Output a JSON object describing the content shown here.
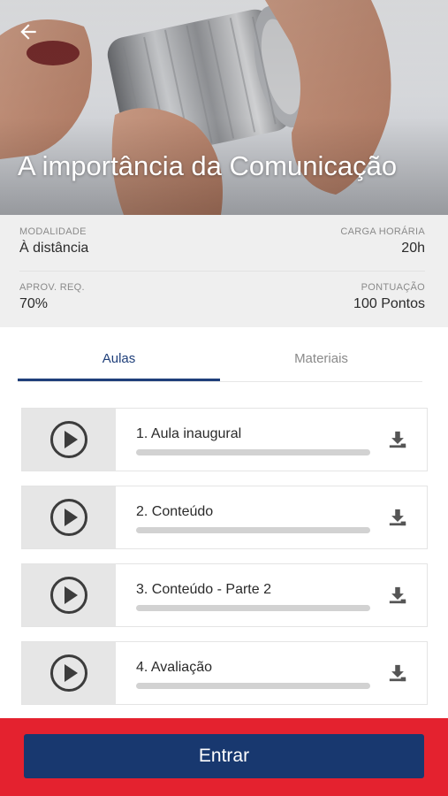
{
  "course": {
    "title": "A importância da Comunicação"
  },
  "icons": {
    "back": "arrow-left-icon",
    "play": "play-circle-icon",
    "download": "download-icon"
  },
  "info": {
    "modality_label": "MODALIDADE",
    "modality_value": "À distância",
    "hours_label": "CARGA HORÁRIA",
    "hours_value": "20h",
    "approval_label": "APROV. REQ.",
    "approval_value": "70%",
    "score_label": "PONTUAÇÃO",
    "score_value": "100 Pontos"
  },
  "tabs": [
    {
      "label": "Aulas",
      "active": true
    },
    {
      "label": "Materiais",
      "active": false
    }
  ],
  "lessons": [
    {
      "title": "1. Aula inaugural",
      "progress": 0
    },
    {
      "title": "2. Conteúdo",
      "progress": 0
    },
    {
      "title": "3. Conteúdo - Parte 2",
      "progress": 0
    },
    {
      "title": "4. Avaliação",
      "progress": 0
    }
  ],
  "footer": {
    "enter_label": "Entrar"
  },
  "colors": {
    "primary": "#18386f",
    "footer_bg": "#e4222f",
    "active_tab": "#1f3f7a",
    "info_bg": "#efefef"
  }
}
